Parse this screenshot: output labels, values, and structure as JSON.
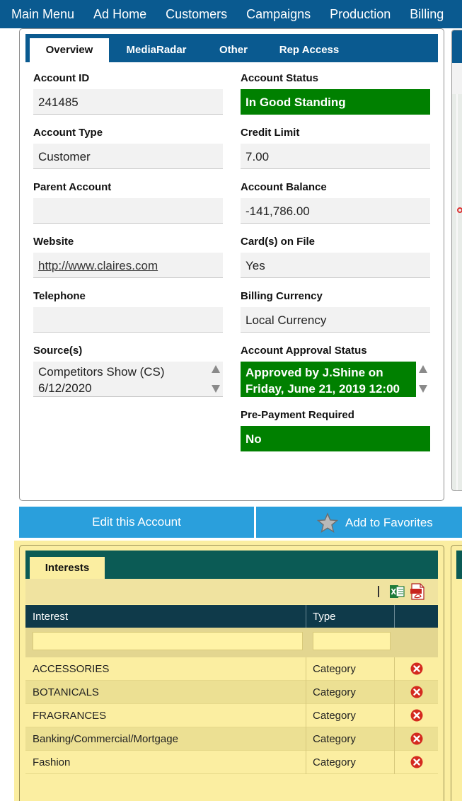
{
  "nav": {
    "items": [
      "Main Menu",
      "Ad Home",
      "Customers",
      "Campaigns",
      "Production",
      "Billing"
    ]
  },
  "account": {
    "tabs": [
      "Overview",
      "MediaRadar",
      "Other",
      "Rep Access"
    ],
    "active_tab": "Overview",
    "fields": {
      "account_id": {
        "label": "Account ID",
        "value": "241485"
      },
      "account_status": {
        "label": "Account Status",
        "value": "In Good Standing"
      },
      "account_type": {
        "label": "Account Type",
        "value": "Customer"
      },
      "credit_limit": {
        "label": "Credit Limit",
        "value": "7.00"
      },
      "parent_account": {
        "label": "Parent Account",
        "value": ""
      },
      "account_balance": {
        "label": "Account Balance",
        "value": "-141,786.00"
      },
      "website": {
        "label": "Website",
        "value": "http://www.claires.com"
      },
      "cards_on_file": {
        "label": "Card(s) on File",
        "value": "Yes"
      },
      "telephone": {
        "label": "Telephone",
        "value": ""
      },
      "billing_currency": {
        "label": "Billing Currency",
        "value": "Local Currency"
      },
      "sources": {
        "label": "Source(s)",
        "line1": "Competitors Show (CS)",
        "line2": "6/12/2020"
      },
      "approval_status": {
        "label": "Account Approval Status",
        "line1": "Approved by J.Shine on",
        "line2": "Friday, June 21, 2019 12:00"
      },
      "prepayment": {
        "label": "Pre-Payment Required",
        "value": "No"
      }
    },
    "status_color": "#008000"
  },
  "actions": {
    "edit_label": "Edit this Account",
    "favorites_label": "Add to Favorites"
  },
  "interests": {
    "tab_label": "Interests",
    "columns": {
      "interest": "Interest",
      "type": "Type"
    },
    "rows": [
      {
        "interest": "ACCESSORIES",
        "type": "Category"
      },
      {
        "interest": "BOTANICALS",
        "type": "Category"
      },
      {
        "interest": "FRAGRANCES",
        "type": "Category"
      },
      {
        "interest": "Banking/Commercial/Mortgage",
        "type": "Category"
      },
      {
        "interest": "Fashion",
        "type": "Category"
      }
    ],
    "icons": [
      "excel-icon",
      "pdf-icon",
      "delete-icon"
    ]
  }
}
